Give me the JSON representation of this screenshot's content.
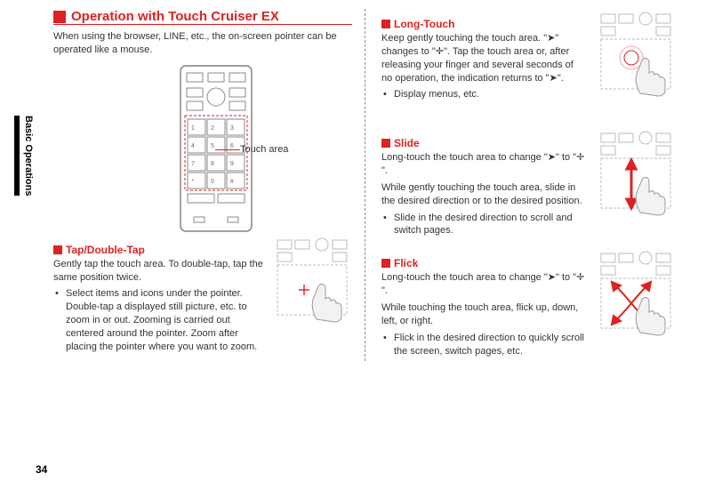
{
  "side_tab": "Basic Operations",
  "page_number": "34",
  "main_title": "Operation with Touch Cruiser EX",
  "intro": "When using the browser, LINE, etc., the on-screen pointer can be operated like a mouse.",
  "touch_area_label": "Touch area",
  "cursor_glyph": "➤",
  "crosshair_glyph": "✛",
  "tap": {
    "title": "Tap/Double-Tap",
    "body": "Gently tap the touch area. To double-tap, tap the same position twice.",
    "bullet": "Select items and icons under the pointer. Double-tap a displayed still picture, etc. to zoom in or out. Zooming is carried out centered around the pointer. Zoom after placing the pointer where you want to zoom."
  },
  "longtouch": {
    "title": "Long-Touch",
    "body_a": "Keep gently touching the touch area. \"",
    "body_b": "\" changes to \"",
    "body_c": "\". Tap the touch area or, after releasing your finger and several seconds of no operation, the indication returns to \"",
    "body_d": "\".",
    "bullet": "Display menus, etc."
  },
  "slide": {
    "title": "Slide",
    "body_a": "Long-touch the touch area to change \"",
    "body_b": "\" to \"",
    "body_c": "\".",
    "body2": "While gently touching the touch area, slide in the desired direction or to the desired position.",
    "bullet": "Slide in the desired direction to scroll and switch pages."
  },
  "flick": {
    "title": "Flick",
    "body_a": "Long-touch the touch area to change \"",
    "body_b": "\" to \"",
    "body_c": "\".",
    "body2": "While touching the touch area, flick up, down, left, or right.",
    "bullet": "Flick in the desired direction to quickly scroll the screen, switch pages, etc."
  }
}
